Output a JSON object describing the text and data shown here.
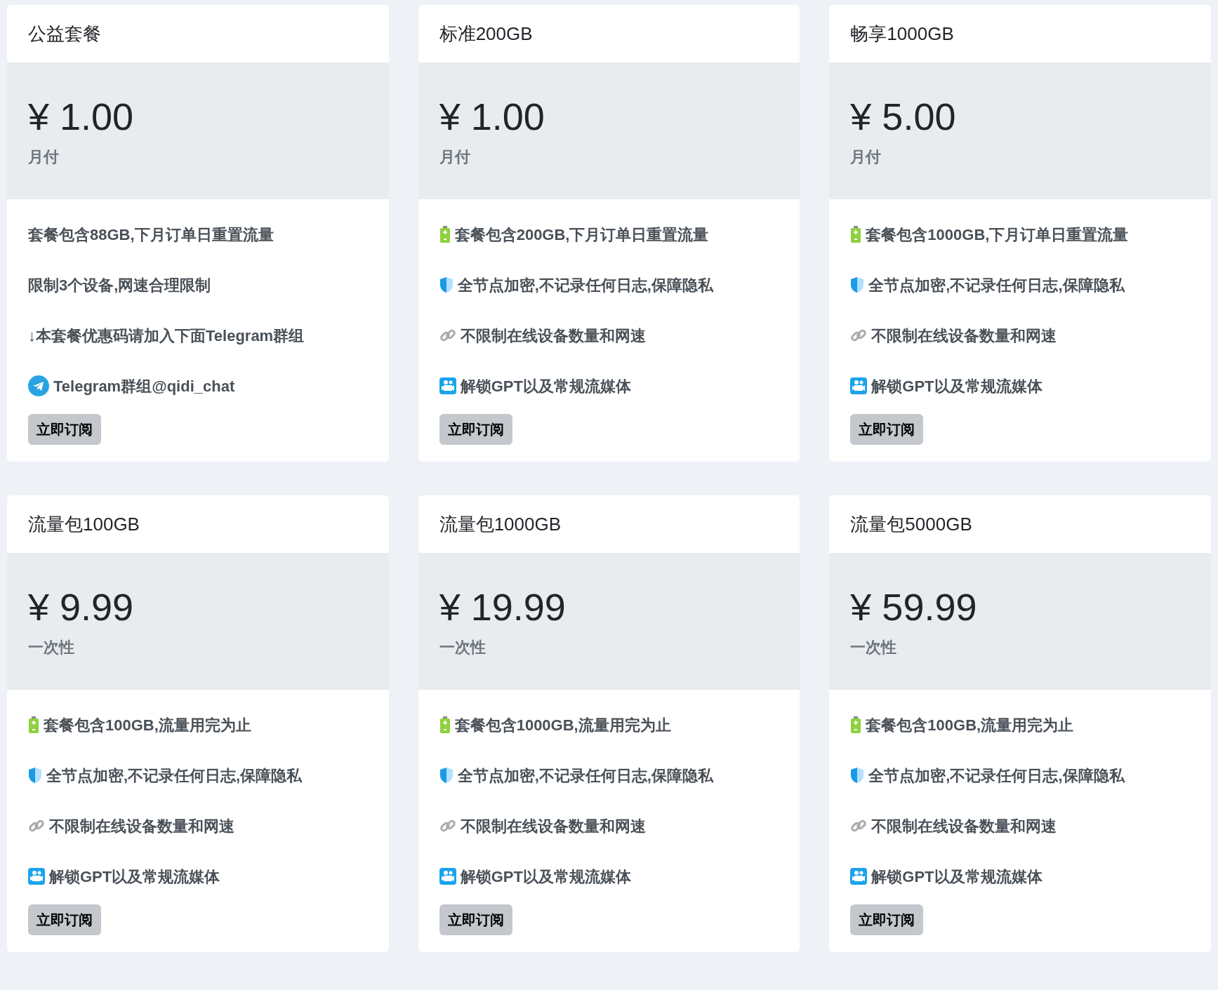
{
  "plans": [
    {
      "name": "公益套餐",
      "price": "¥ 1.00",
      "period": "月付",
      "features": [
        {
          "kind": "plain",
          "text": "套餐包含88GB,下月订单日重置流量"
        },
        {
          "kind": "plain",
          "text": "限制3个设备,网速合理限制"
        },
        {
          "kind": "plain",
          "text": "↓本套餐优惠码请加入下面Telegram群组"
        },
        {
          "kind": "telegram",
          "text": "Telegram群组@qidi_chat"
        }
      ],
      "button": "立即订阅"
    },
    {
      "name": "标准200GB",
      "price": "¥ 1.00",
      "period": "月付",
      "features": [
        {
          "kind": "battery",
          "text": "套餐包含200GB,下月订单日重置流量"
        },
        {
          "kind": "shield",
          "text": "全节点加密,不记录任何日志,保障隐私"
        },
        {
          "kind": "link",
          "text": "不限制在线设备数量和网速"
        },
        {
          "kind": "video",
          "text": "解锁GPT以及常规流媒体"
        }
      ],
      "button": "立即订阅"
    },
    {
      "name": "畅享1000GB",
      "price": "¥ 5.00",
      "period": "月付",
      "features": [
        {
          "kind": "battery",
          "text": "套餐包含1000GB,下月订单日重置流量"
        },
        {
          "kind": "shield",
          "text": "全节点加密,不记录任何日志,保障隐私"
        },
        {
          "kind": "link",
          "text": "不限制在线设备数量和网速"
        },
        {
          "kind": "video",
          "text": "解锁GPT以及常规流媒体"
        }
      ],
      "button": "立即订阅"
    },
    {
      "name": "流量包100GB",
      "price": "¥ 9.99",
      "period": "一次性",
      "features": [
        {
          "kind": "battery",
          "text": "套餐包含100GB,流量用完为止"
        },
        {
          "kind": "shield",
          "text": "全节点加密,不记录任何日志,保障隐私"
        },
        {
          "kind": "link",
          "text": "不限制在线设备数量和网速"
        },
        {
          "kind": "video",
          "text": "解锁GPT以及常规流媒体"
        }
      ],
      "button": "立即订阅"
    },
    {
      "name": "流量包1000GB",
      "price": "¥ 19.99",
      "period": "一次性",
      "features": [
        {
          "kind": "battery",
          "text": "套餐包含1000GB,流量用完为止"
        },
        {
          "kind": "shield",
          "text": "全节点加密,不记录任何日志,保障隐私"
        },
        {
          "kind": "link",
          "text": "不限制在线设备数量和网速"
        },
        {
          "kind": "video",
          "text": "解锁GPT以及常规流媒体"
        }
      ],
      "button": "立即订阅"
    },
    {
      "name": "流量包5000GB",
      "price": "¥ 59.99",
      "period": "一次性",
      "features": [
        {
          "kind": "battery",
          "text": "套餐包含100GB,流量用完为止"
        },
        {
          "kind": "shield",
          "text": "全节点加密,不记录任何日志,保障隐私"
        },
        {
          "kind": "link",
          "text": "不限制在线设备数量和网速"
        },
        {
          "kind": "video",
          "text": "解锁GPT以及常规流媒体"
        }
      ],
      "button": "立即订阅"
    }
  ]
}
